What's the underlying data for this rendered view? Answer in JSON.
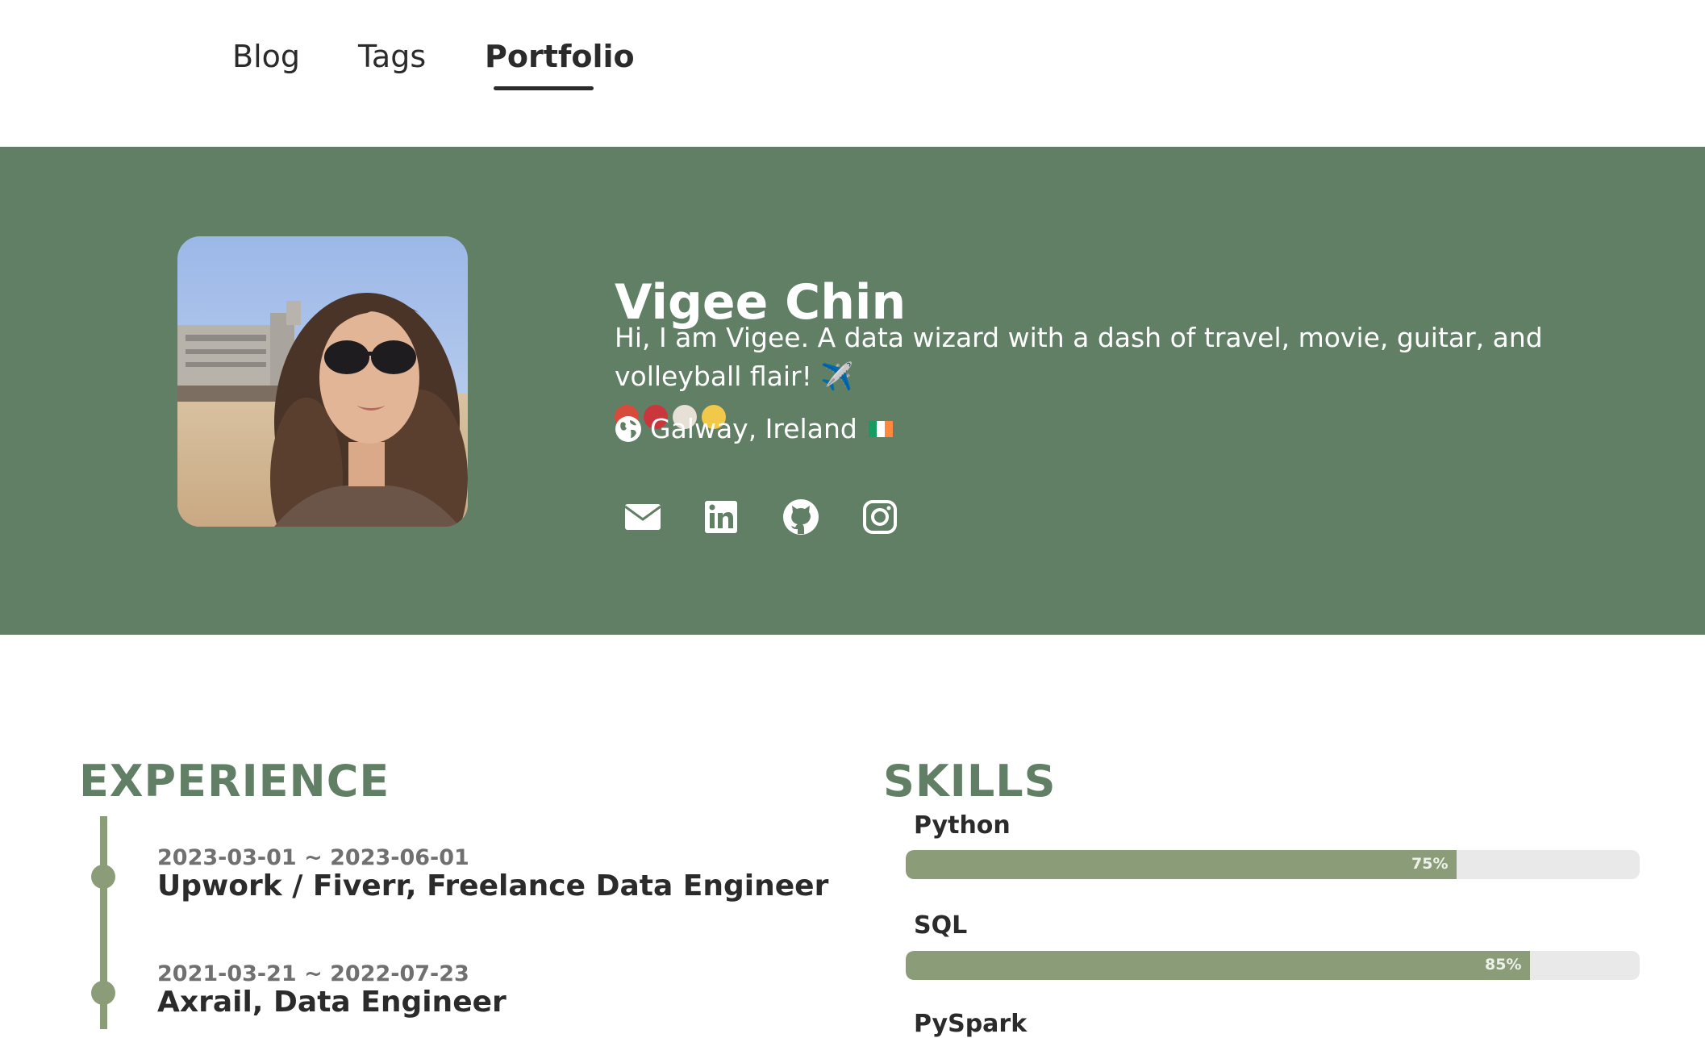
{
  "nav": {
    "items": [
      {
        "label": "Blog"
      },
      {
        "label": "Tags"
      },
      {
        "label": "Portfolio",
        "active": true
      }
    ]
  },
  "hero": {
    "name": "Vigee Chin",
    "bio": "Hi, I am Vigee. A data wizard with a dash of travel, movie, guitar, and volleyball flair! ✈️",
    "bio_emojis": [
      "popcorn",
      "guitar",
      "volleyball",
      "sparkles"
    ],
    "location": "Galway, Ireland",
    "location_icon": "globe-icon",
    "flag": "Ireland flag",
    "socials": [
      "email-icon",
      "linkedin-icon",
      "github-icon",
      "instagram-icon"
    ],
    "background_color": "#607f64"
  },
  "experience": {
    "heading": "EXPERIENCE",
    "items": [
      {
        "date": "2023-03-01 ~ 2023-06-01",
        "title": "Upwork / Fiverr, Freelance Data Engineer"
      },
      {
        "date": "2021-03-21 ~ 2022-07-23",
        "title": "Axrail, Data Engineer"
      }
    ]
  },
  "skills": {
    "heading": "SKILLS",
    "items": [
      {
        "name": "Python",
        "percent": 75,
        "label": "75%"
      },
      {
        "name": "SQL",
        "percent": 85,
        "label": "85%"
      },
      {
        "name": "PySpark"
      }
    ],
    "bar_color": "#8a9c78"
  }
}
